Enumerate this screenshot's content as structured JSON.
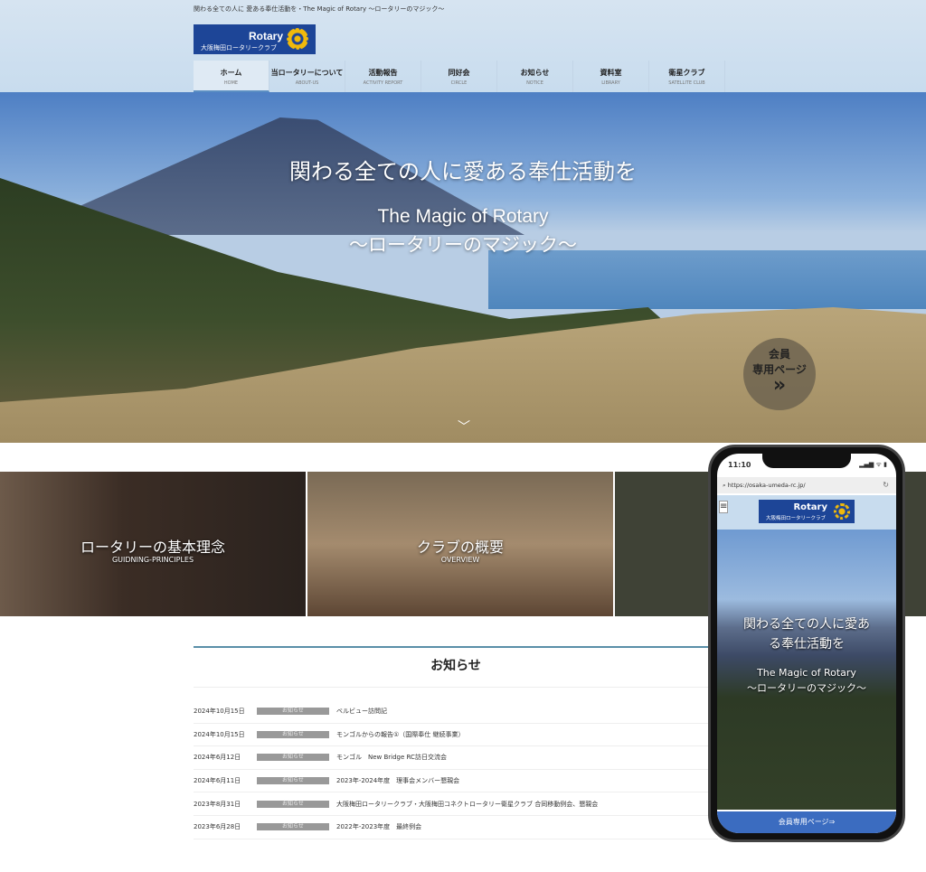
{
  "header": {
    "tagline": "関わる全ての人に 愛ある奉仕活動を・The Magic of Rotary ～ロータリーのマジック～",
    "logo": {
      "brand": "Rotary",
      "club": "大阪梅田ロータリークラブ"
    },
    "nav": [
      {
        "jp": "ホーム",
        "en": "HOME"
      },
      {
        "jp": "当ロータリーについて",
        "en": "ABOUT-US"
      },
      {
        "jp": "活動報告",
        "en": "ACTIVITY REPORT"
      },
      {
        "jp": "同好会",
        "en": "CIRCLE"
      },
      {
        "jp": "お知らせ",
        "en": "NOTICE"
      },
      {
        "jp": "資料室",
        "en": "LIBRARY"
      },
      {
        "jp": "衛星クラブ",
        "en": "SATELLITE CLUB"
      }
    ]
  },
  "hero": {
    "title": "関わる全ての人に愛ある奉仕活動を",
    "sub1": "The Magic of Rotary",
    "sub2": "～ロータリーのマジック～",
    "member_l1": "会員",
    "member_l2": "専用ページ",
    "member_icon": "double-chevron-right",
    "scroll_icon": "chevron-down"
  },
  "cards": [
    {
      "title": "ロータリーの基本理念",
      "en": "GUIDNING-PRINCIPLES"
    },
    {
      "title": "クラブの概要",
      "en": "OVERVIEW"
    }
  ],
  "notice": {
    "title": "お知らせ",
    "items": [
      {
        "date": "2024年10月15日",
        "badge": "お知らせ",
        "text": "ベルビュー訪問記"
      },
      {
        "date": "2024年10月15日",
        "badge": "お知らせ",
        "text": "モンゴルからの報告①（国際奉仕 継続事業）"
      },
      {
        "date": "2024年6月12日",
        "badge": "お知らせ",
        "text": "モンゴル　New Bridge RC訪日交流会"
      },
      {
        "date": "2024年6月11日",
        "badge": "お知らせ",
        "text": "2023年-2024年度　理事会メンバー懇親会"
      },
      {
        "date": "2023年8月31日",
        "badge": "お知らせ",
        "text": "大阪梅田ロータリークラブ・大阪梅田コネクトロータリー衛星クラブ 合同移動例会、懇親会"
      },
      {
        "date": "2023年6月28日",
        "badge": "お知らせ",
        "text": "2022年-2023年度　最終例会"
      }
    ]
  },
  "phone": {
    "time": "11:10",
    "status": "▂▄▆ ᯤ ▮",
    "url": "https://osaka-umeda-rc.jp/",
    "brand": "Rotary",
    "club": "大阪梅田ロータリークラブ",
    "title_l1": "関わる全ての人に愛あ",
    "title_l2": "る奉仕活動を",
    "sub1": "The Magic of Rotary",
    "sub2": "～ロータリーのマジック～",
    "button": "会員専用ページ⇒"
  },
  "colors": {
    "brand": "#1d4597",
    "accent": "#f0b90b",
    "phone_button": "#3b6cc0"
  }
}
